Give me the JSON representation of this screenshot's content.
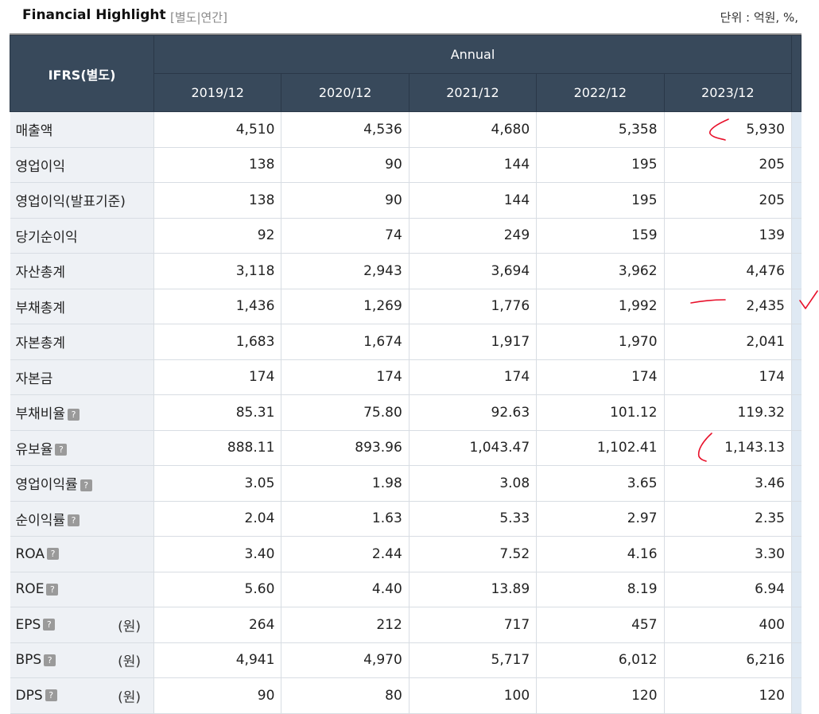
{
  "header": {
    "title": "Financial Highlight",
    "subtitle": "[별도|연간]",
    "unit": "단위 : 억원, %,"
  },
  "table": {
    "corner": "IFRS(별도)",
    "group": "Annual",
    "years": [
      "2019/12",
      "2020/12",
      "2021/12",
      "2022/12",
      "2023/12"
    ],
    "rows": [
      {
        "label": "매출액",
        "help": false,
        "unit": "",
        "values": [
          "4,510",
          "4,536",
          "4,680",
          "5,358",
          "5,930"
        ]
      },
      {
        "label": "영업이익",
        "help": false,
        "unit": "",
        "values": [
          "138",
          "90",
          "144",
          "195",
          "205"
        ]
      },
      {
        "label": "영업이익(발표기준)",
        "help": false,
        "unit": "",
        "values": [
          "138",
          "90",
          "144",
          "195",
          "205"
        ]
      },
      {
        "label": "당기순이익",
        "help": false,
        "unit": "",
        "values": [
          "92",
          "74",
          "249",
          "159",
          "139"
        ]
      },
      {
        "label": "자산총계",
        "help": false,
        "unit": "",
        "values": [
          "3,118",
          "2,943",
          "3,694",
          "3,962",
          "4,476"
        ]
      },
      {
        "label": "부채총계",
        "help": false,
        "unit": "",
        "values": [
          "1,436",
          "1,269",
          "1,776",
          "1,992",
          "2,435"
        ]
      },
      {
        "label": "자본총계",
        "help": false,
        "unit": "",
        "values": [
          "1,683",
          "1,674",
          "1,917",
          "1,970",
          "2,041"
        ]
      },
      {
        "label": "자본금",
        "help": false,
        "unit": "",
        "values": [
          "174",
          "174",
          "174",
          "174",
          "174"
        ]
      },
      {
        "label": "부채비율",
        "help": true,
        "unit": "",
        "values": [
          "85.31",
          "75.80",
          "92.63",
          "101.12",
          "119.32"
        ]
      },
      {
        "label": "유보율",
        "help": true,
        "unit": "",
        "values": [
          "888.11",
          "893.96",
          "1,043.47",
          "1,102.41",
          "1,143.13"
        ]
      },
      {
        "label": "영업이익률",
        "help": true,
        "unit": "",
        "values": [
          "3.05",
          "1.98",
          "3.08",
          "3.65",
          "3.46"
        ]
      },
      {
        "label": "순이익률",
        "help": true,
        "unit": "",
        "values": [
          "2.04",
          "1.63",
          "5.33",
          "2.97",
          "2.35"
        ]
      },
      {
        "label": "ROA",
        "help": true,
        "unit": "",
        "values": [
          "3.40",
          "2.44",
          "7.52",
          "4.16",
          "3.30"
        ]
      },
      {
        "label": "ROE",
        "help": true,
        "unit": "",
        "values": [
          "5.60",
          "4.40",
          "13.89",
          "8.19",
          "6.94"
        ]
      },
      {
        "label": "EPS",
        "help": true,
        "unit": "(원)",
        "values": [
          "264",
          "212",
          "717",
          "457",
          "400"
        ]
      },
      {
        "label": "BPS",
        "help": true,
        "unit": "(원)",
        "values": [
          "4,941",
          "4,970",
          "5,717",
          "6,012",
          "6,216"
        ]
      },
      {
        "label": "DPS",
        "help": true,
        "unit": "(원)",
        "values": [
          "90",
          "80",
          "100",
          "120",
          "120"
        ]
      }
    ]
  },
  "help_glyph": "?",
  "colors": {
    "header_bg": "#38495b",
    "label_bg": "#eef1f5",
    "annotation": "#e8102a",
    "scroll_track": "#dfe9f3"
  }
}
